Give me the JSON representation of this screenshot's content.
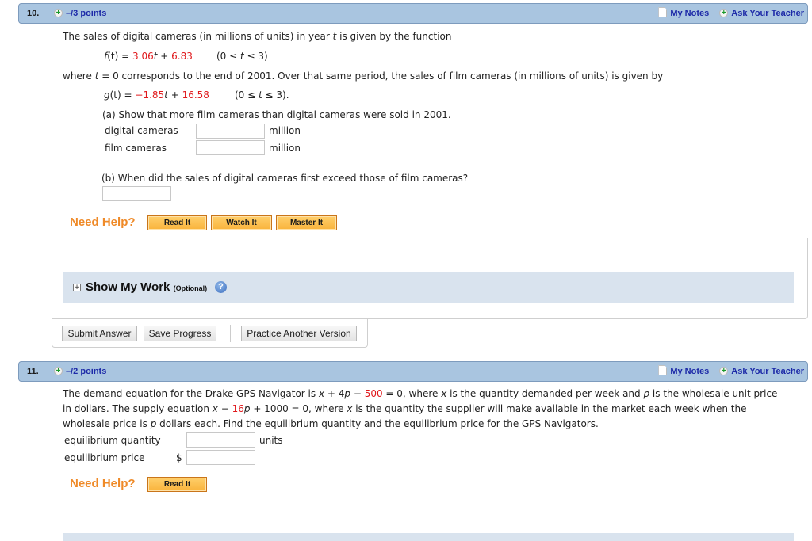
{
  "questions": [
    {
      "number": "10.",
      "points": "–/3 points",
      "my_notes": "My Notes",
      "ask_teacher": "Ask Your Teacher",
      "intro": "The sales of digital cameras (in millions of units) in year",
      "intro_var": "t",
      "intro_end": "is given by the function",
      "f_name": "f",
      "f_arg": "(t) = ",
      "f_coef": "3.06",
      "f_var": "t",
      "f_plus": " + ",
      "f_const": "6.83",
      "f_domain_open": "(0 ≤ ",
      "f_domain_var": "t",
      "f_domain_close": " ≤ 3)",
      "where_start": "where",
      "where_var": "t",
      "where_end": "= 0 corresponds to the end of 2001. Over that same period, the sales of film cameras (in millions of units) is given by",
      "g_name": "g",
      "g_arg": "(t) = ",
      "g_coef": "−1.85",
      "g_var": "t",
      "g_plus": " + ",
      "g_const": "16.58",
      "g_domain_open": "(0 ≤ ",
      "g_domain_var": "t",
      "g_domain_close": " ≤ 3).",
      "part_a": "(a) Show that more film cameras than digital cameras were sold in 2001.",
      "fields": [
        {
          "label": "digital cameras",
          "value": "",
          "unit": "million"
        },
        {
          "label": "film cameras",
          "value": "",
          "unit": "million"
        }
      ],
      "part_b": "(b) When did the sales of digital cameras first exceed those of film cameras?",
      "part_b_value": "",
      "need_help": "Need Help?",
      "help_buttons": [
        "Read It",
        "Watch It",
        "Master It"
      ],
      "show_my_work": "Show My Work",
      "show_my_work_optional": "(Optional)",
      "help_icon": "?",
      "actions": {
        "submit": "Submit Answer",
        "save": "Save Progress",
        "practice": "Practice Another Version"
      }
    },
    {
      "number": "11.",
      "points": "–/2 points",
      "my_notes": "My Notes",
      "ask_teacher": "Ask Your Teacher",
      "line1_a": "The demand equation for the Drake GPS Navigator is ",
      "line1_eq1": "x",
      "line1_eq2": " + 4",
      "line1_eq3": "p",
      "line1_eq4": " − ",
      "line1_red": "500",
      "line1_eq5": " = 0,  where ",
      "line1_x": "x",
      "line1_b": " is the quantity demanded per week and ",
      "line1_p": "p",
      "line1_c": " is the wholesale unit price",
      "line2_a": "in dollars. The supply equation ",
      "line2_x": "x",
      "line2_minus": " − ",
      "line2_red": "16",
      "line2_p": "p",
      "line2_b": " + 1000 = 0,  where ",
      "line2_x2": "x",
      "line2_c": " is the quantity the supplier will make available in the market each week when the",
      "line3_a": "wholesale price is ",
      "line3_p": "p",
      "line3_b": " dollars each. Find the equilibrium quantity and the equilibrium price for the GPS Navigators.",
      "fields": [
        {
          "label": "equilibrium quantity",
          "prefix": "",
          "value": "",
          "unit": "units"
        },
        {
          "label": "equilibrium price",
          "prefix": "$",
          "value": "",
          "unit": ""
        }
      ],
      "need_help": "Need Help?",
      "help_buttons": [
        "Read It"
      ]
    }
  ]
}
